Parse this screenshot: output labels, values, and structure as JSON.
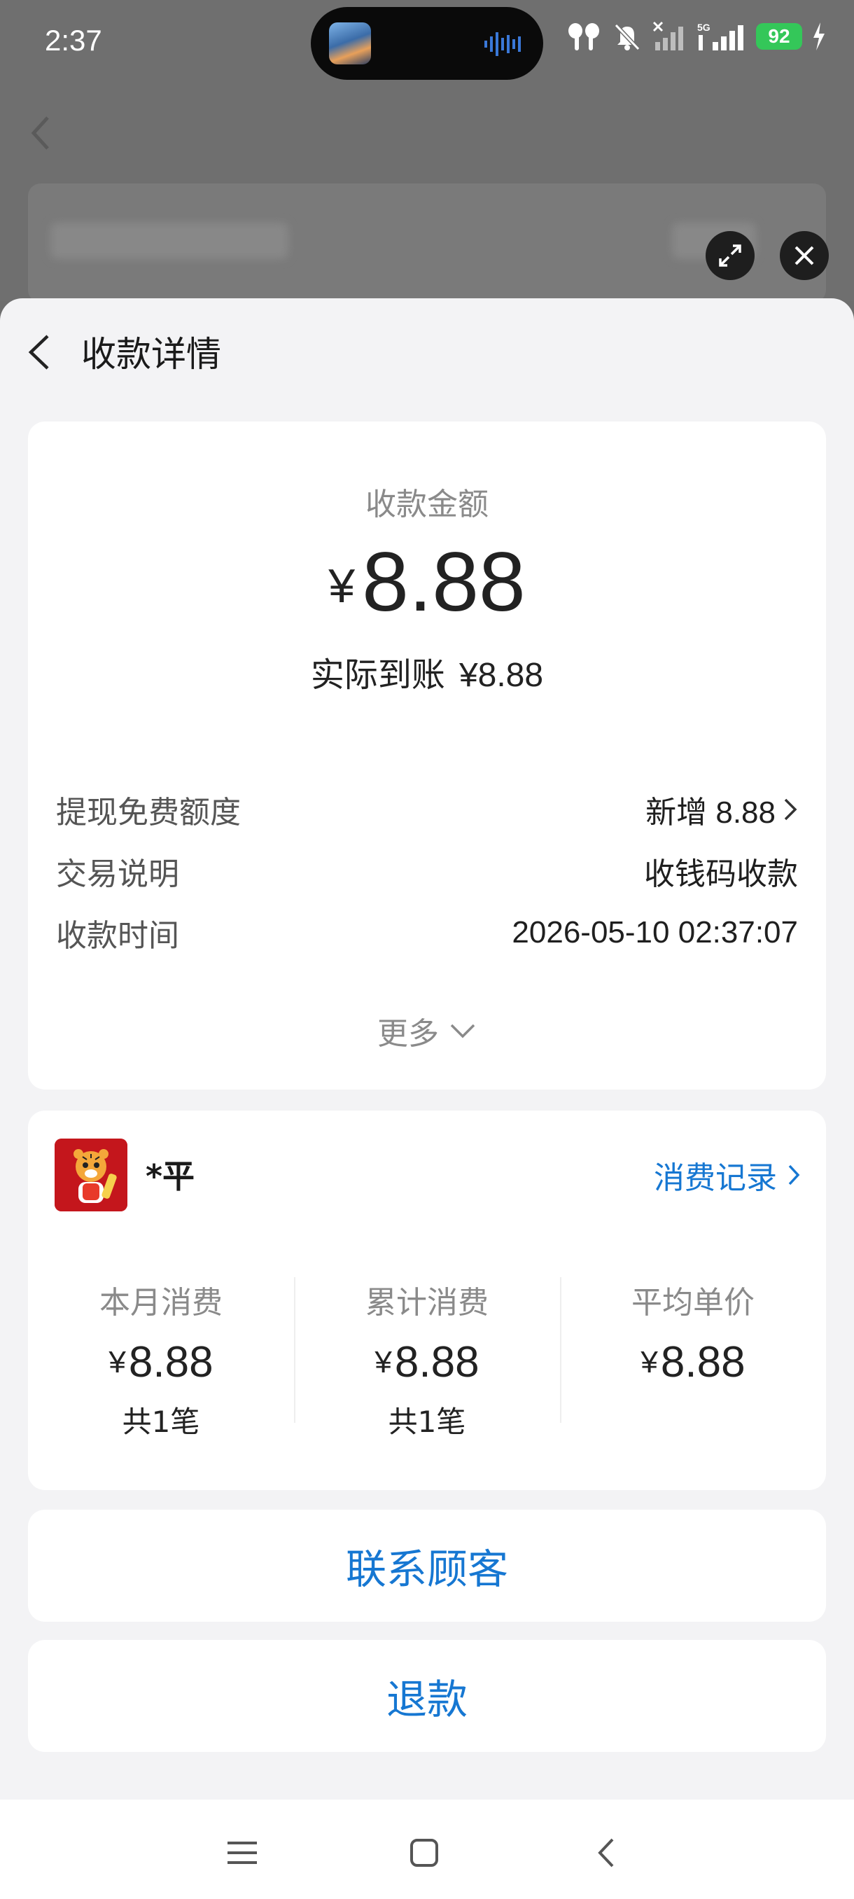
{
  "status_bar": {
    "time": "2:37",
    "battery": "92"
  },
  "header": {
    "title": "收款详情"
  },
  "amount": {
    "label": "收款金额",
    "currency": "¥",
    "value": "8.88",
    "actual_label": "实际到账",
    "actual_value": "¥8.88"
  },
  "details": [
    {
      "key": "提现免费额度",
      "value": "新增 8.88"
    },
    {
      "key": "交易说明",
      "value": "收钱码收款"
    },
    {
      "key": "收款时间",
      "value": "2026-05-10 02:37:07"
    }
  ],
  "more_label": "更多",
  "customer": {
    "name": "*平",
    "records_link": "消费记录",
    "stats": [
      {
        "label": "本月消费",
        "currency": "¥",
        "value": "8.88",
        "count": "共1笔"
      },
      {
        "label": "累计消费",
        "currency": "¥",
        "value": "8.88",
        "count": "共1笔"
      },
      {
        "label": "平均单价",
        "currency": "¥",
        "value": "8.88"
      }
    ]
  },
  "actions": {
    "contact": "联系顾客",
    "refund": "退款"
  },
  "colors": {
    "accent": "#1677d2",
    "battery": "#34c759",
    "avatar_bg": "#c4161c"
  }
}
